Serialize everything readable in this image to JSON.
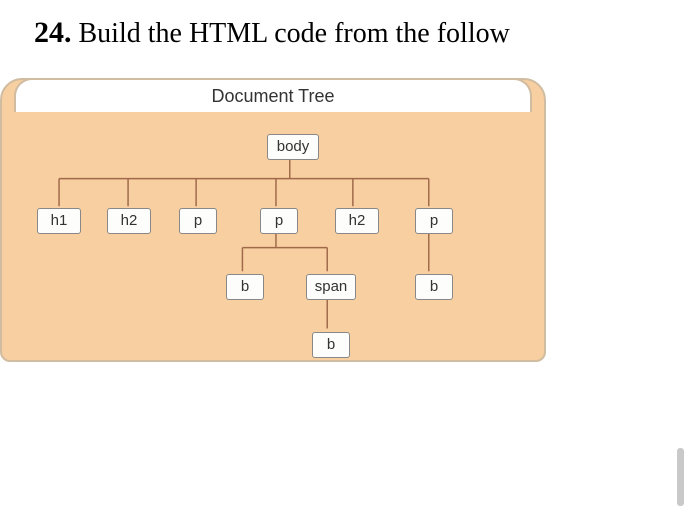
{
  "question": {
    "number": "24.",
    "text": "Build the HTML code from the follow"
  },
  "panel": {
    "title": "Document Tree"
  },
  "nodes": {
    "body": "body",
    "h1": "h1",
    "h2a": "h2",
    "pa": "p",
    "pb": "p",
    "h2b": "h2",
    "pc": "p",
    "ba": "b",
    "span": "span",
    "bb": "b",
    "bc": "b"
  }
}
